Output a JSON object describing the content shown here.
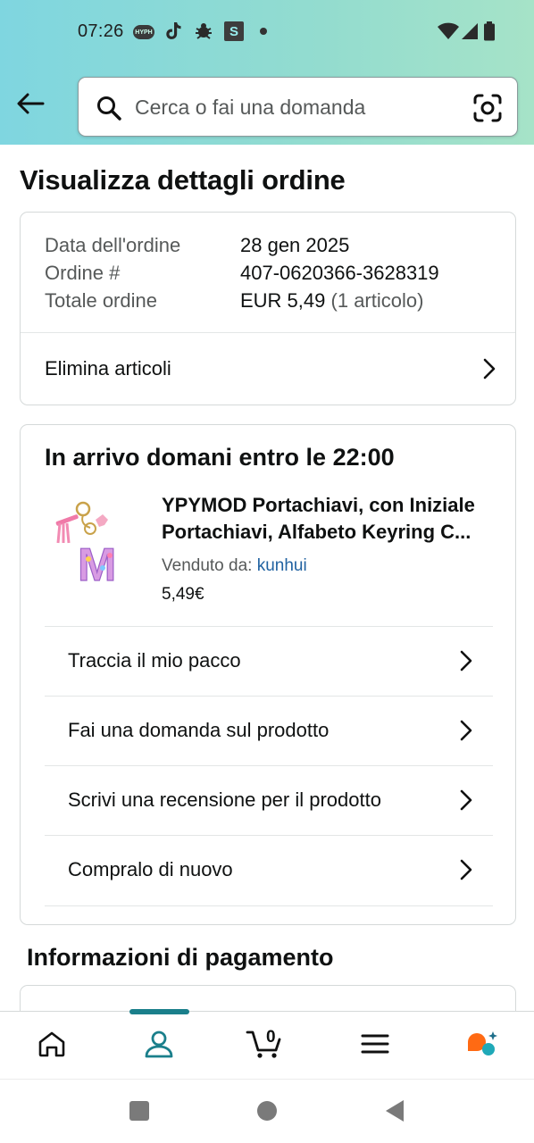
{
  "status_bar": {
    "time": "07:26",
    "hyph_label": "HYPH",
    "s_label": "S"
  },
  "header": {
    "search_placeholder": "Cerca o fai una domanda"
  },
  "page": {
    "title": "Visualizza dettagli ordine"
  },
  "order_summary": {
    "rows": [
      {
        "label": "Data dell'ordine",
        "value": "28 gen 2025"
      },
      {
        "label": "Ordine #",
        "value": "407-0620366-3628319"
      },
      {
        "label": "Totale ordine",
        "value": "EUR 5,49",
        "extra": "(1 articolo)"
      }
    ],
    "delete_items_label": "Elimina articoli"
  },
  "delivery": {
    "title": "In arrivo domani entro le 22:00",
    "product": {
      "title_line1": "YPYMOD Portachiavi, con Iniziale",
      "title_line2": "Portachiavi, Alfabeto Keyring C...",
      "sold_by_label": "Venduto da:",
      "seller": "kunhui",
      "price": "5,49€",
      "thumb_letter": "M"
    },
    "actions": [
      {
        "label": "Traccia il mio pacco"
      },
      {
        "label": "Fai una domanda sul prodotto"
      },
      {
        "label": "Scrivi una recensione per il prodotto"
      },
      {
        "label": "Compralo di nuovo"
      }
    ]
  },
  "payment": {
    "section_title": "Informazioni di pagamento"
  },
  "bottom_nav": {
    "cart_count": "0",
    "active_item": "account",
    "accent_color": "#1a7f8b"
  }
}
